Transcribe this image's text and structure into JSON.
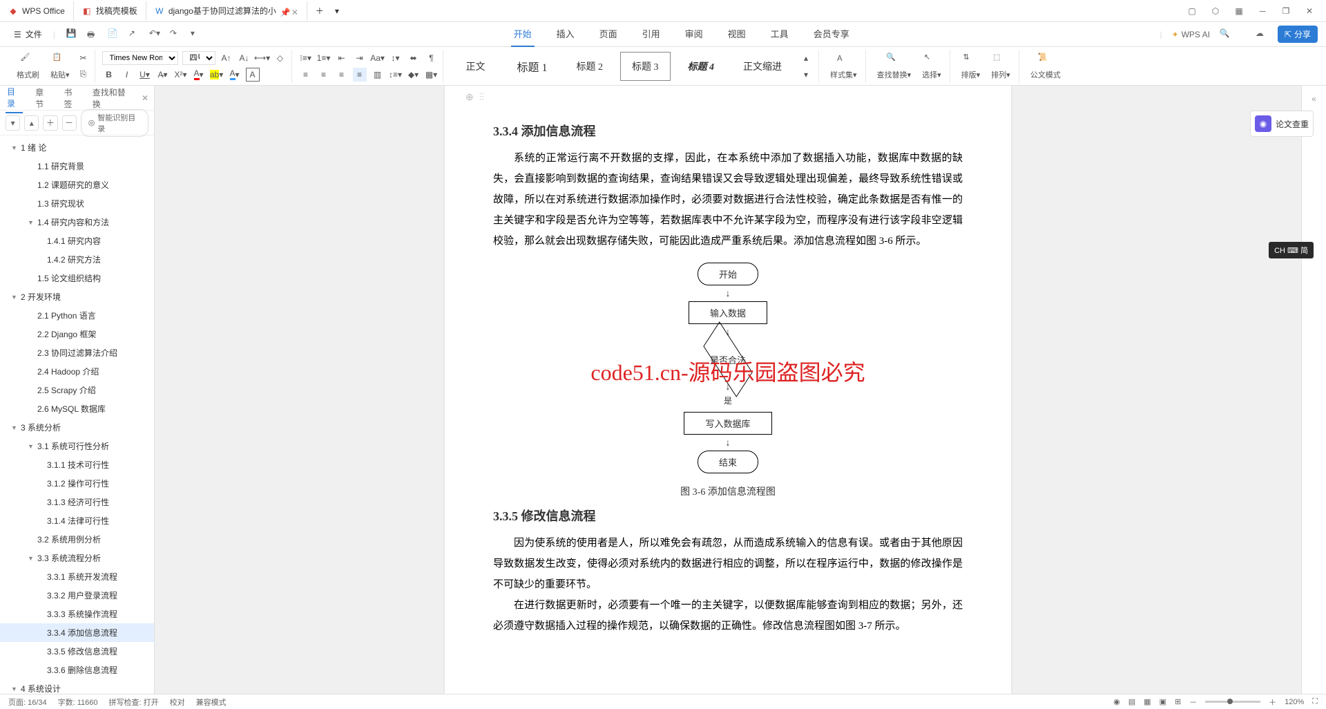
{
  "app": {
    "name": "WPS Office"
  },
  "tabs": [
    {
      "label": "WPS Office",
      "icon": "wps"
    },
    {
      "label": "找稿壳模板",
      "icon": "template"
    },
    {
      "label": "django基于协同过滤算法的小",
      "icon": "doc",
      "active": true
    }
  ],
  "file_menu": "文件",
  "menu_tabs": [
    "开始",
    "插入",
    "页面",
    "引用",
    "审阅",
    "视图",
    "工具",
    "会员专享"
  ],
  "active_menu": "开始",
  "wps_ai": "WPS AI",
  "share": "分享",
  "ribbon": {
    "format_brush": "格式刷",
    "paste": "粘贴",
    "font": "Times New Roma",
    "size": "四号",
    "styles": {
      "normal": "正文",
      "h1": "标题 1",
      "h2": "标题 2",
      "h3": "标题 3",
      "h4": "标题 4",
      "indent": "正文缩进"
    },
    "style_set": "样式集",
    "find_replace": "查找替换",
    "select": "选择",
    "sort": "排版",
    "arrange": "排列",
    "official": "公文模式"
  },
  "sidebar": {
    "tabs": [
      "目录",
      "章节",
      "书签",
      "查找和替换"
    ],
    "active_tab": "目录",
    "smart": "智能识别目录",
    "toc": [
      {
        "num": "1",
        "text": "绪    论",
        "level": 1,
        "expand": true
      },
      {
        "num": "1.1",
        "text": "研究背景",
        "level": 2
      },
      {
        "num": "1.2",
        "text": "课题研究的意义",
        "level": 2
      },
      {
        "num": "1.3",
        "text": "研究现状",
        "level": 2
      },
      {
        "num": "1.4",
        "text": "研究内容和方法",
        "level": 2,
        "expand": true
      },
      {
        "num": "1.4.1",
        "text": "研究内容",
        "level": 3
      },
      {
        "num": "1.4.2",
        "text": "研究方法",
        "level": 3
      },
      {
        "num": "1.5",
        "text": "论文组织结构",
        "level": 2
      },
      {
        "num": "2",
        "text": "开发环境",
        "level": 1,
        "expand": true
      },
      {
        "num": "2.1",
        "text": "Python 语言",
        "level": 2
      },
      {
        "num": "2.2",
        "text": "Django 框架",
        "level": 2
      },
      {
        "num": "2.3",
        "text": "协同过滤算法介绍",
        "level": 2
      },
      {
        "num": "2.4",
        "text": "Hadoop 介绍",
        "level": 2
      },
      {
        "num": "2.5",
        "text": "Scrapy 介绍",
        "level": 2
      },
      {
        "num": "2.6",
        "text": "MySQL 数据库",
        "level": 2
      },
      {
        "num": "3",
        "text": "系统分析",
        "level": 1,
        "expand": true
      },
      {
        "num": "3.1",
        "text": "系统可行性分析",
        "level": 2,
        "expand": true
      },
      {
        "num": "3.1.1",
        "text": "技术可行性",
        "level": 3
      },
      {
        "num": "3.1.2",
        "text": "操作可行性",
        "level": 3
      },
      {
        "num": "3.1.3",
        "text": "经济可行性",
        "level": 3
      },
      {
        "num": "3.1.4",
        "text": "法律可行性",
        "level": 3
      },
      {
        "num": "3.2",
        "text": "系统用例分析",
        "level": 2
      },
      {
        "num": "3.3",
        "text": "系统流程分析",
        "level": 2,
        "expand": true
      },
      {
        "num": "3.3.1",
        "text": "系统开发流程",
        "level": 3
      },
      {
        "num": "3.3.2",
        "text": "用户登录流程",
        "level": 3
      },
      {
        "num": "3.3.3",
        "text": "系统操作流程",
        "level": 3
      },
      {
        "num": "3.3.4",
        "text": "添加信息流程",
        "level": 3,
        "selected": true
      },
      {
        "num": "3.3.5",
        "text": "修改信息流程",
        "level": 3
      },
      {
        "num": "3.3.6",
        "text": "删除信息流程",
        "level": 3
      },
      {
        "num": "4",
        "text": "系统设计",
        "level": 1,
        "expand": true
      }
    ]
  },
  "document": {
    "h334": "3.3.4  添加信息流程",
    "p334": "系统的正常运行离不开数据的支撑，因此，在本系统中添加了数据插入功能，数据库中数据的缺失，会直接影响到数据的查询结果，查询结果错误又会导致逻辑处理出现偏差，最终导致系统性错误或故障，所以在对系统进行数据添加操作时，必须要对数据进行合法性校验，确定此条数据是否有惟一的主关键字和字段是否允许为空等等，若数据库表中不允许某字段为空，而程序没有进行该字段非空逻辑校验，那么就会出现数据存储失败，可能因此造成严重系统后果。添加信息流程如图 3-6 所示。",
    "fc": {
      "start": "开始",
      "input": "输入数据",
      "check": "是否合法",
      "yes": "是",
      "write": "写入数据库",
      "end": "结束"
    },
    "cap36": "图 3-6 添加信息流程图",
    "h335": "3.3.5  修改信息流程",
    "p335a": "因为使系统的使用者是人，所以难免会有疏忽，从而造成系统输入的信息有误。或者由于其他原因导致数据发生改变，使得必须对系统内的数据进行相应的调整，所以在程序运行中，数据的修改操作是不可缺少的重要环节。",
    "p335b": "在进行数据更新时，必须要有一个唯一的主关键字，以便数据库能够查询到相应的数据；另外，还必须遵守数据插入过程的操作规范，以确保数据的正确性。修改信息流程图如图 3-7 所示。",
    "watermark": "code51.cn-源码乐园盗图必究"
  },
  "right_panel": {
    "review": "论文查重"
  },
  "ime": "CH ⌨ 简",
  "status": {
    "page": "页面: 16/34",
    "words": "字数: 11660",
    "spell": "拼写检查: 打开",
    "proof": "校对",
    "mode": "兼容模式",
    "zoom": "120%"
  }
}
